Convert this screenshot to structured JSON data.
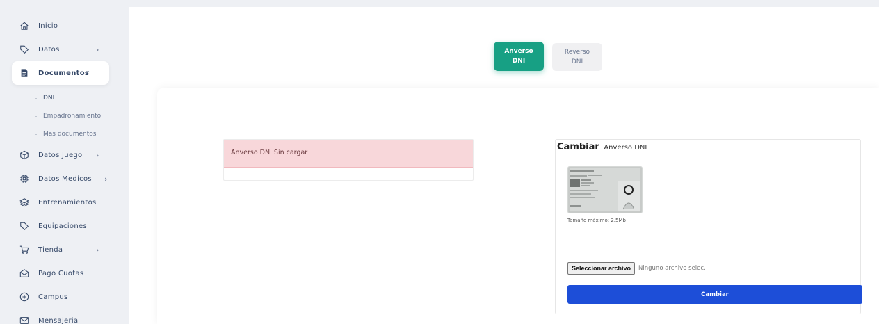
{
  "sidebar": {
    "items": [
      {
        "label": "Inicio",
        "icon": "home-icon"
      },
      {
        "label": "Datos",
        "icon": "tag-icon",
        "chevron": "›"
      },
      {
        "label": "Documentos",
        "icon": "document-icon",
        "chevron": "⌄"
      },
      {
        "label": "Datos Juego",
        "icon": "cube-icon",
        "chevron": "›"
      },
      {
        "label": "Datos Medicos",
        "icon": "chip-icon",
        "chevron": "›"
      },
      {
        "label": "Entrenamientos",
        "icon": "layers-icon"
      },
      {
        "label": "Equipaciones",
        "icon": "tag-icon"
      },
      {
        "label": "Tienda",
        "icon": "cart-icon",
        "chevron": "›"
      },
      {
        "label": "Pago Cuotas",
        "icon": "envelope-open-icon"
      },
      {
        "label": "Campus",
        "icon": "compass-icon"
      },
      {
        "label": "Mensajeria",
        "icon": "mail-icon"
      }
    ],
    "subitems": [
      {
        "label": "DNI"
      },
      {
        "label": "Empadronamiento"
      },
      {
        "label": "Mas documentos"
      }
    ]
  },
  "tabs": {
    "front": {
      "line1": "Anverso",
      "line2": "DNI"
    },
    "back": {
      "line1": "Reverso",
      "line2": "DNI"
    }
  },
  "alert": {
    "text": "Anverso DNI Sin cargar"
  },
  "upload": {
    "title": "Cambiar",
    "subtitle": "Anverso DNI",
    "size_note": "Tamaño máximo: 2.5Mb",
    "file_button": "Seleccionar archivo",
    "file_status": "Ninguno archivo selec.",
    "submit_label": "Cambiar"
  },
  "colors": {
    "accent": "#17a084",
    "primary": "#1d4ed8",
    "alert_bg": "#f8d7da"
  }
}
